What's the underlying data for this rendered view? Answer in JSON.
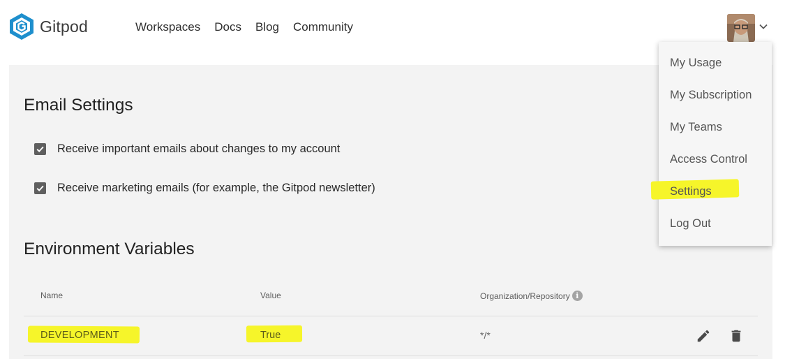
{
  "brand": {
    "name": "Gitpod",
    "color": "#1e8fcd"
  },
  "nav": [
    {
      "label": "Workspaces"
    },
    {
      "label": "Docs"
    },
    {
      "label": "Blog"
    },
    {
      "label": "Community"
    }
  ],
  "user_menu": {
    "items": [
      {
        "label": "My Usage"
      },
      {
        "label": "My Subscription"
      },
      {
        "label": "My Teams"
      },
      {
        "label": "Access Control"
      },
      {
        "label": "Settings",
        "highlighted": true
      },
      {
        "label": "Log Out"
      }
    ]
  },
  "email_settings": {
    "title": "Email Settings",
    "options": [
      {
        "label": "Receive important emails about changes to my account",
        "checked": true
      },
      {
        "label": "Receive marketing emails (for example, the Gitpod newsletter)",
        "checked": true
      }
    ]
  },
  "env_vars": {
    "title": "Environment Variables",
    "columns": {
      "name": "Name",
      "value": "Value",
      "org": "Organization/Repository",
      "info_glyph": "i"
    },
    "rows": [
      {
        "name": "DEVELOPMENT",
        "value": "True",
        "org": "*/*"
      }
    ]
  },
  "colors": {
    "highlight": "#f6f52a",
    "main_bg": "#f3f3f3",
    "checkbox": "#5f5f5f"
  },
  "icons": {
    "edit": "pencil-icon",
    "delete": "trash-icon",
    "dropdown": "chevron-down-icon",
    "info": "info-icon"
  }
}
